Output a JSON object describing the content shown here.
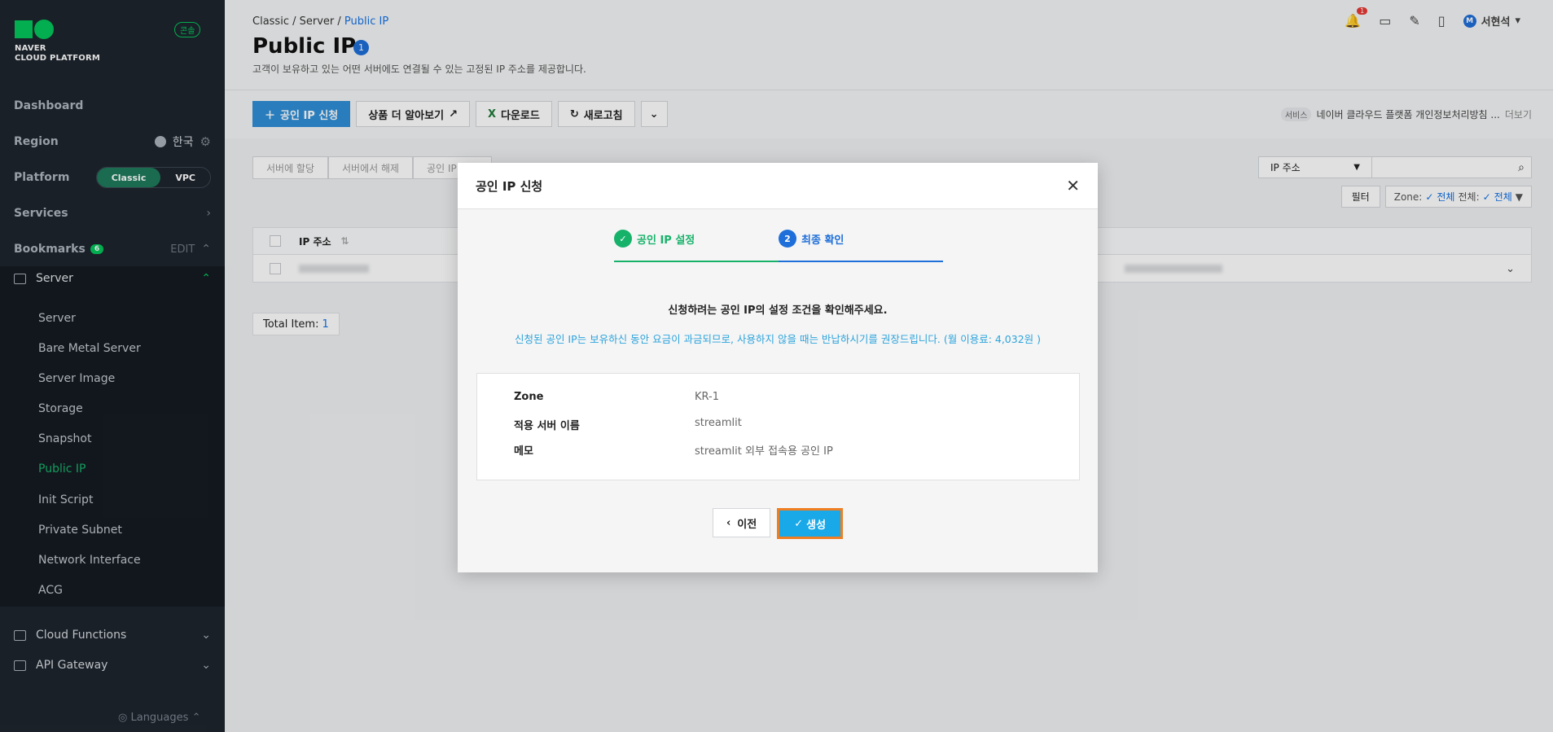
{
  "sidebar": {
    "logo_line1": "NAVER",
    "logo_line2": "CLOUD PLATFORM",
    "console_badge": "콘솔",
    "dashboard": "Dashboard",
    "region_label": "Region",
    "region_value": "한국",
    "platform_label": "Platform",
    "platform_options": [
      "Classic",
      "VPC"
    ],
    "platform_selected": "Classic",
    "services": "Services",
    "bookmarks": "Bookmarks",
    "bookmarks_count": "6",
    "edit": "EDIT",
    "server_group": "Server",
    "server_items": [
      "Server",
      "Bare Metal Server",
      "Server Image",
      "Storage",
      "Snapshot",
      "Public IP",
      "Init Script",
      "Private Subnet",
      "Network Interface",
      "ACG"
    ],
    "active_item": "Public IP",
    "cloud_functions": "Cloud Functions",
    "api_gateway": "API Gateway",
    "languages": "Languages"
  },
  "header": {
    "breadcrumb": [
      "Classic",
      "Server",
      "Public IP"
    ],
    "title": "Public IP",
    "title_badge": "1",
    "description": "고객이 보유하고 있는 어떤 서버에도 연결될 수 있는 고정된 IP 주소를 제공합니다.",
    "notification_count": "1",
    "user_initial": "M",
    "user_name": "서현석"
  },
  "toolbar": {
    "apply": "공인 IP 신청",
    "learn_more": "상품 더 알아보기",
    "download": "다운로드",
    "refresh": "새로고침"
  },
  "service_link": {
    "tag": "서비스",
    "text": "네이버 클라우드 플랫폼 개인정보처리방침 ...",
    "more": "더보기"
  },
  "sub_tabs": [
    "서버에 할당",
    "서버에서 해제",
    "공인 IP 반납"
  ],
  "search": {
    "select_value": "IP 주소"
  },
  "filter": {
    "label": "필터",
    "zone_label": "Zone:",
    "zone_value": "전체",
    "all_label": "전체:",
    "all_value": "전체"
  },
  "table": {
    "header_ip": "IP 주소"
  },
  "total": {
    "label": "Total Item:",
    "count": "1"
  },
  "modal": {
    "title": "공인 IP 신청",
    "step1_label": "공인 IP 설정",
    "step2_number": "2",
    "step2_label": "최종 확인",
    "question": "신청하려는 공인 IP의 설정 조건을 확인해주세요.",
    "note": "신청된 공인 IP는 보유하신 동안 요금이 과금되므로, 사용하지 않을 때는 반납하시기를 권장드립니다. (월 이용료: 4,032원 )",
    "details": [
      {
        "key": "Zone",
        "value": "KR-1"
      },
      {
        "key": "적용 서버 이름",
        "value": "streamlit"
      },
      {
        "key": "메모",
        "value": "streamlit 외부 접속용 공인 IP"
      }
    ],
    "prev_button": "이전",
    "create_button": "생성"
  }
}
